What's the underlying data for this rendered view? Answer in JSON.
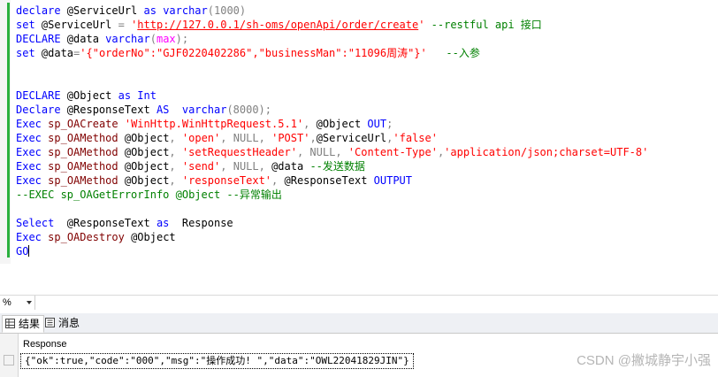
{
  "editor": {
    "lines": [
      [
        {
          "t": "declare",
          "c": "kw"
        },
        {
          "t": " @ServiceUrl ",
          "c": ""
        },
        {
          "t": "as",
          "c": "kw"
        },
        {
          "t": " ",
          "c": ""
        },
        {
          "t": "varchar",
          "c": "kw"
        },
        {
          "t": "(1000)",
          "c": "gr"
        }
      ],
      [
        {
          "t": "set",
          "c": "kw"
        },
        {
          "t": " @ServiceUrl ",
          "c": ""
        },
        {
          "t": "=",
          "c": "gr"
        },
        {
          "t": " '",
          "c": "str"
        },
        {
          "t": "http://127.0.0.1/sh-oms/openApi/order/create",
          "c": "url"
        },
        {
          "t": "'",
          "c": "str"
        },
        {
          "t": " --restful api 接口",
          "c": "cm"
        }
      ],
      [
        {
          "t": "DECLARE",
          "c": "kw"
        },
        {
          "t": " @data ",
          "c": ""
        },
        {
          "t": "varchar",
          "c": "kw"
        },
        {
          "t": "(",
          "c": "gr"
        },
        {
          "t": "max",
          "c": "mg"
        },
        {
          "t": ");",
          "c": "gr"
        }
      ],
      [
        {
          "t": "set",
          "c": "kw"
        },
        {
          "t": " @data",
          "c": ""
        },
        {
          "t": "=",
          "c": "gr"
        },
        {
          "t": "'{\"orderNo\":\"GJF0220402286\",\"businessMan\":\"11096周涛\"}'",
          "c": "str"
        },
        {
          "t": "   --入参",
          "c": "cm"
        }
      ],
      [],
      [],
      [
        {
          "t": "DECLARE",
          "c": "kw"
        },
        {
          "t": " @Object ",
          "c": ""
        },
        {
          "t": "as",
          "c": "kw"
        },
        {
          "t": " ",
          "c": ""
        },
        {
          "t": "Int",
          "c": "kw"
        }
      ],
      [
        {
          "t": "Declare",
          "c": "kw"
        },
        {
          "t": " @ResponseText ",
          "c": ""
        },
        {
          "t": "AS",
          "c": "kw"
        },
        {
          "t": "  ",
          "c": ""
        },
        {
          "t": "varchar",
          "c": "kw"
        },
        {
          "t": "(8000);",
          "c": "gr"
        }
      ],
      [
        {
          "t": "Exec",
          "c": "kw"
        },
        {
          "t": " ",
          "c": ""
        },
        {
          "t": "sp_OACreate",
          "c": "fn"
        },
        {
          "t": " ",
          "c": ""
        },
        {
          "t": "'WinHttp.WinHttpRequest.5.1'",
          "c": "str"
        },
        {
          "t": ",",
          "c": "gr"
        },
        {
          "t": " @Object ",
          "c": ""
        },
        {
          "t": "OUT",
          "c": "kw"
        },
        {
          "t": ";",
          "c": "gr"
        }
      ],
      [
        {
          "t": "Exec",
          "c": "kw"
        },
        {
          "t": " ",
          "c": ""
        },
        {
          "t": "sp_OAMethod",
          "c": "fn"
        },
        {
          "t": " @Object",
          "c": ""
        },
        {
          "t": ",",
          "c": "gr"
        },
        {
          "t": " ",
          "c": ""
        },
        {
          "t": "'open'",
          "c": "str"
        },
        {
          "t": ",",
          "c": "gr"
        },
        {
          "t": " ",
          "c": ""
        },
        {
          "t": "NULL",
          "c": "gr"
        },
        {
          "t": ",",
          "c": "gr"
        },
        {
          "t": " ",
          "c": ""
        },
        {
          "t": "'POST'",
          "c": "str"
        },
        {
          "t": ",",
          "c": "gr"
        },
        {
          "t": "@ServiceUrl",
          "c": ""
        },
        {
          "t": ",",
          "c": "gr"
        },
        {
          "t": "'false'",
          "c": "str"
        }
      ],
      [
        {
          "t": "Exec",
          "c": "kw"
        },
        {
          "t": " ",
          "c": ""
        },
        {
          "t": "sp_OAMethod",
          "c": "fn"
        },
        {
          "t": " @Object",
          "c": ""
        },
        {
          "t": ",",
          "c": "gr"
        },
        {
          "t": " ",
          "c": ""
        },
        {
          "t": "'setRequestHeader'",
          "c": "str"
        },
        {
          "t": ",",
          "c": "gr"
        },
        {
          "t": " ",
          "c": ""
        },
        {
          "t": "NULL",
          "c": "gr"
        },
        {
          "t": ",",
          "c": "gr"
        },
        {
          "t": " ",
          "c": ""
        },
        {
          "t": "'Content-Type'",
          "c": "str"
        },
        {
          "t": ",",
          "c": "gr"
        },
        {
          "t": "'application/json;charset=UTF-8'",
          "c": "str"
        }
      ],
      [
        {
          "t": "Exec",
          "c": "kw"
        },
        {
          "t": " ",
          "c": ""
        },
        {
          "t": "sp_OAMethod",
          "c": "fn"
        },
        {
          "t": " @Object",
          "c": ""
        },
        {
          "t": ",",
          "c": "gr"
        },
        {
          "t": " ",
          "c": ""
        },
        {
          "t": "'send'",
          "c": "str"
        },
        {
          "t": ",",
          "c": "gr"
        },
        {
          "t": " ",
          "c": ""
        },
        {
          "t": "NULL",
          "c": "gr"
        },
        {
          "t": ",",
          "c": "gr"
        },
        {
          "t": " @data ",
          "c": ""
        },
        {
          "t": "--发送数据",
          "c": "cm"
        }
      ],
      [
        {
          "t": "Exec",
          "c": "kw"
        },
        {
          "t": " ",
          "c": ""
        },
        {
          "t": "sp_OAMethod",
          "c": "fn"
        },
        {
          "t": " @Object",
          "c": ""
        },
        {
          "t": ",",
          "c": "gr"
        },
        {
          "t": " ",
          "c": ""
        },
        {
          "t": "'responseText'",
          "c": "str"
        },
        {
          "t": ",",
          "c": "gr"
        },
        {
          "t": " @ResponseText ",
          "c": ""
        },
        {
          "t": "OUTPUT",
          "c": "kw"
        }
      ],
      [
        {
          "t": "--EXEC sp_OAGetErrorInfo @Object --异常输出",
          "c": "cm"
        }
      ],
      [],
      [
        {
          "t": "Select",
          "c": "kw"
        },
        {
          "t": "  @ResponseText ",
          "c": ""
        },
        {
          "t": "as",
          "c": "kw"
        },
        {
          "t": "  Response",
          "c": ""
        }
      ],
      [
        {
          "t": "Exec",
          "c": "kw"
        },
        {
          "t": " ",
          "c": ""
        },
        {
          "t": "sp_OADestroy",
          "c": "fn"
        },
        {
          "t": " @Object",
          "c": ""
        }
      ],
      [
        {
          "t": "GO",
          "c": "kw"
        }
      ]
    ]
  },
  "zoom": {
    "value": "%"
  },
  "tabs": [
    {
      "label": "结果",
      "icon": "grid-icon",
      "active": true
    },
    {
      "label": "消息",
      "icon": "messages-icon",
      "active": false
    }
  ],
  "results": {
    "column": "Response",
    "row_value": "{\"ok\":true,\"code\":\"000\",\"msg\":\"操作成功! \",\"data\":\"OWL22041829JIN\"}"
  },
  "watermark": "CSDN @撇城静宇小强",
  "colors": {
    "keyword": "#0000ff",
    "string": "#ff0000",
    "comment": "#008000",
    "function": "#800000",
    "gray": "#808080",
    "magenta": "#ff00ff"
  }
}
